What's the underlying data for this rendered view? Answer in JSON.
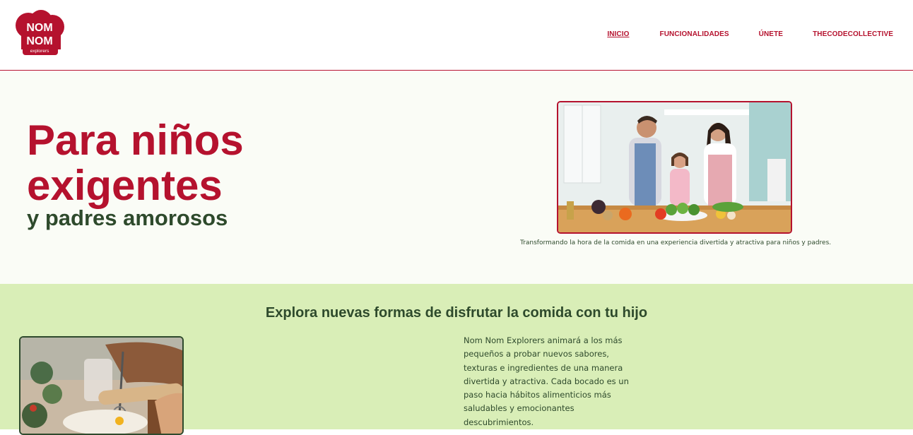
{
  "logo": {
    "line1": "NOM",
    "line2": "NOM",
    "line3": "explorers"
  },
  "nav": {
    "items": [
      {
        "label": "INICIO"
      },
      {
        "label": "FUNCIONALIDADES"
      },
      {
        "label": "ÚNETE"
      },
      {
        "label": "THECODECOLLECTIVE"
      }
    ]
  },
  "hero": {
    "title_line1": "Para niños",
    "title_line2": "exigentes",
    "subtitle": "y padres amorosos",
    "caption": "Transformando la hora de la comida en una experiencia divertida y atractiva para niños y padres."
  },
  "section": {
    "title": "Explora nuevas formas de disfrutar la comida con tu hijo",
    "text": "Nom Nom Explorers animará a los más pequeños a probar nuevos sabores, texturas e ingredientes de una manera divertida y atractiva. Cada bocado es un paso hacia hábitos alimenticios más saludables y emocionantes descubrimientos."
  },
  "colors": {
    "brand_red": "#b5122e",
    "dark_green": "#2e4a2c",
    "light_green": "#d9eeb7",
    "hero_bg": "#fafcf6"
  }
}
